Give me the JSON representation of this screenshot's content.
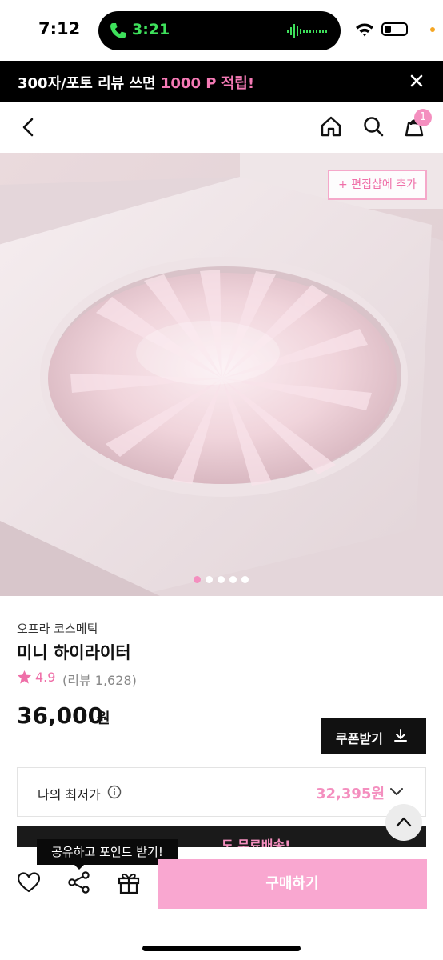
{
  "status_bar": {
    "time": "7:12",
    "call_time": "3:21"
  },
  "promo_banner": {
    "text": "300자/포토 리뷰 쓰면 ",
    "highlight": "1000 P 적립!"
  },
  "nav": {
    "cart_count": "1"
  },
  "hero": {
    "edit_shop_label": "+ 편집샵에 추가",
    "carousel_total": 5,
    "carousel_active": 1
  },
  "product": {
    "brand": "오프라 코스메틱",
    "name": "미니 하이라이터",
    "rating": "4.9",
    "review_count": "(리뷰 1,628)",
    "price": "36,000",
    "price_unit": "원"
  },
  "coupon": {
    "label": "쿠폰받기"
  },
  "lowest_price": {
    "label": "나의 최저가",
    "value": "32,395원"
  },
  "shipping_strip": {
    "text": "도 무료배송!"
  },
  "bottom_bar": {
    "share_tooltip": "공유하고 포인트 받기!",
    "buy_label": "구매하기"
  },
  "colors": {
    "accent_pink": "#f48fbf",
    "buy_button": "#f9a7d0",
    "call_green": "#3ee05b"
  },
  "icons": [
    "back-icon",
    "home-icon",
    "search-icon",
    "bag-icon",
    "star-icon",
    "download-icon",
    "info-icon",
    "chevron-down-icon",
    "chevron-up-icon",
    "heart-icon",
    "share-icon",
    "gift-icon",
    "close-icon"
  ]
}
